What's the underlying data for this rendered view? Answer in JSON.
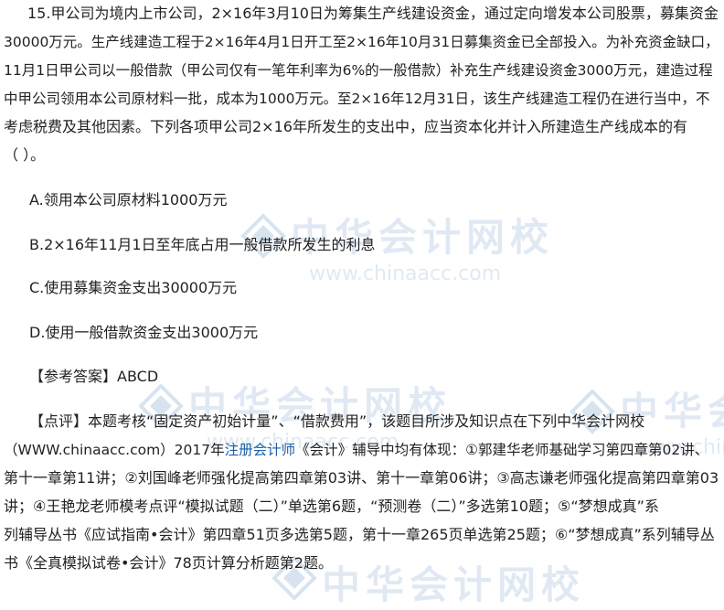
{
  "question": {
    "lines": [
      "15.甲公司为境内上市公司，2×16年3月10日为筹集生产线建设资金，通过定向增发本公司股票，募集资金",
      "30000万元。生产线建造工程于2×16年4月1日开工至2×16年10月31日募集资金已全部投入。为补充资金缺口，",
      "11月1日甲公司以一般借款（甲公司仅有一笔年利率为6%的一般借款）补充生产线建设资金3000万元，建造过程",
      "中甲公司领用本公司原材料一批，成本为1000万元。至2×16年12月31日，该生产线建造工程仍在进行当中，不",
      "考虑税费及其他因素。下列各项甲公司2×16年所发生的支出中，应当资本化并计入所建造生产线成本的有",
      "（ ）。"
    ]
  },
  "options": [
    "A.领用本公司原材料1000万元",
    "B.2×16年11月1日至年底占用一般借款所发生的利息",
    "C.使用募集资金支出30000万元",
    "D.使用一般借款资金支出3000万元"
  ],
  "answer": "【参考答案】ABCD",
  "comment": {
    "line1": "【点评】本题考核“固定资产初始计量”、“借款费用”，该题目所涉及知识点在下列中华会计网校",
    "line2_pre": "（WWW.chinaacc.com）2017年",
    "line2_link": "注册会计师",
    "line2_post": "《会计》辅导中均有体现：①郭建华老师基础学习第四章第02讲、",
    "line3": "第十一章第11讲；②刘国峰老师强化提高第四章第03讲、第十一章第06讲；③高志谦老师强化提高第四章第03",
    "line4": "讲；④王艳龙老师模考点评“模拟试题（二）”单选第6题，“预测卷（二）”多选第10题；⑤“梦想成真”系",
    "line5": "列辅导丛书《应试指南•会计》第四章51页多选第5题，第十一章265页单选第25题；⑥“梦想成真”系列辅导丛",
    "line6": "书《全真模拟试卷•会计》78页计算分析题第2题。"
  },
  "watermark": {
    "name": "中华会计网校",
    "url": "www.chinaacc.com"
  },
  "colors": {
    "text": "#222222",
    "link": "#1d5fa8",
    "watermark": "#2a6cb0"
  }
}
